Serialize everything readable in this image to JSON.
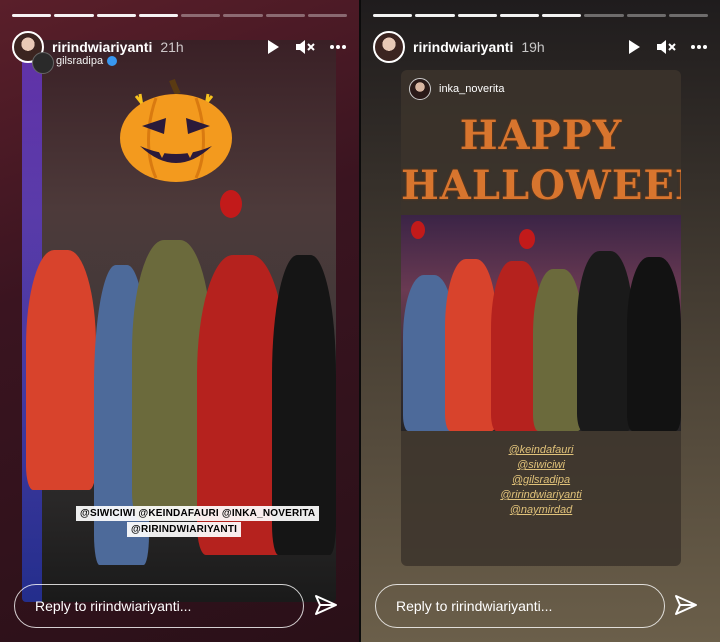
{
  "left": {
    "username": "ririndwiariyanti",
    "time": "21h",
    "sub_username": "gilsradipa",
    "mentions": [
      "@SIWICIWI @KEINDAFAURI @INKA_NOVERITA",
      "@RIRINDWIARIYANTI"
    ],
    "reply_placeholder": "Reply to ririndwiariyanti..."
  },
  "right": {
    "username": "ririndwiariyanti",
    "time": "19h",
    "shared_username": "inka_noverita",
    "headline_1": "HAPPY",
    "headline_2": "HALLOWEEN",
    "mentions": [
      "@keindafauri",
      "@siwiciwi",
      "@gilsradipa",
      "@ririndwiariyanti",
      "@naymirdad"
    ],
    "reply_placeholder": "Reply to ririndwiariyanti..."
  },
  "icons": {
    "play": "play-icon",
    "mute": "speaker-muted-icon",
    "more": "more-dots-icon",
    "send": "send-paper-plane-icon",
    "verified": "verified-badge-icon",
    "pumpkin": "jack-o-lantern-sticker"
  },
  "colors": {
    "accent_orange": "#f39a1e",
    "verified_blue": "#3897f0",
    "headline_orange": "#d8752e",
    "mention_gold": "#e0c27a"
  }
}
